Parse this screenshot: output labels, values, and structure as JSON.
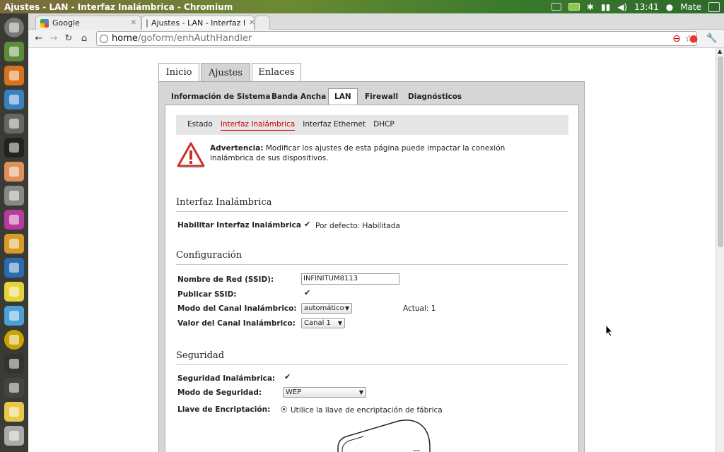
{
  "window": {
    "title": "Ajustes - LAN - Interfaz Inalámbrica - Chromium",
    "clock": "13:41",
    "user": "Mate"
  },
  "browser": {
    "tabs": [
      {
        "label": "Google"
      },
      {
        "label": "Ajustes - LAN - Interfaz I"
      }
    ],
    "url_host": "home",
    "url_path": "/goform/enhAuthHandler"
  },
  "router": {
    "main_tabs": [
      "Inicio",
      "Ajustes",
      "Enlaces"
    ],
    "sub_tabs": [
      "Información de Sistema",
      "Banda Ancha",
      "LAN",
      "Firewall",
      "Diagnósticos"
    ],
    "lan_nav": [
      "Estado",
      "Interfaz Inalámbrica",
      "Interfaz Ethernet",
      "DHCP"
    ],
    "warning_label": "Advertencia:",
    "warning_text": "Modificar los ajustes de esta página puede impactar la conexión inalámbrica de sus dispositivos.",
    "section_interface": "Interfaz Inalámbrica",
    "enable_label": "Habilitar Interfaz Inalámbrica",
    "enable_note": "Por defecto: Habilitada",
    "section_config": "Configuración",
    "ssid_label": "Nombre de Red (SSID):",
    "ssid_value": "INFINITUM8113",
    "publish_label": "Publicar SSID:",
    "channel_mode_label": "Modo del Canal Inalámbrico:",
    "channel_mode_value": "automático",
    "current_channel": "Actual: 1",
    "channel_value_label": "Valor del Canal Inalámbrico:",
    "channel_value": "Canal 1",
    "section_security": "Seguridad",
    "wireless_security_label": "Seguridad Inalámbrica:",
    "security_mode_label": "Modo de Seguridad:",
    "security_mode_value": "WEP",
    "encryption_label": "Llave de Encriptación:",
    "encryption_option": "Utilice la llave de encriptación de fábrica"
  }
}
